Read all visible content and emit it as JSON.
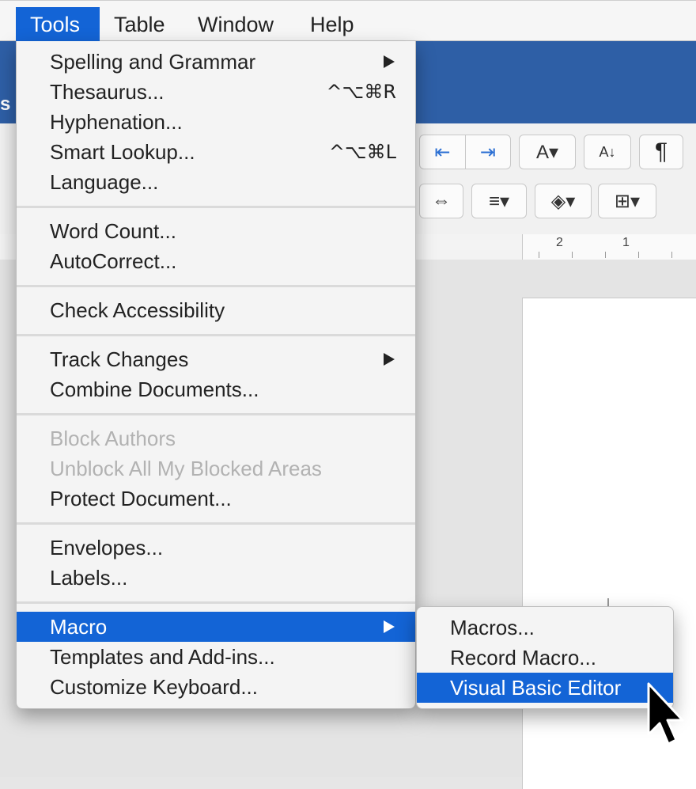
{
  "menubar": {
    "items": [
      {
        "label": "Tools",
        "active": true
      },
      {
        "label": "Table"
      },
      {
        "label": "Window"
      },
      {
        "label": "Help"
      }
    ]
  },
  "tools_menu": {
    "groups": [
      [
        {
          "label": "Spelling and Grammar",
          "submenu": true
        },
        {
          "label": "Thesaurus...",
          "shortcut": "^⌥⌘R"
        },
        {
          "label": "Hyphenation..."
        },
        {
          "label": "Smart Lookup...",
          "shortcut": "^⌥⌘L"
        },
        {
          "label": "Language..."
        }
      ],
      [
        {
          "label": "Word Count..."
        },
        {
          "label": "AutoCorrect..."
        }
      ],
      [
        {
          "label": "Check Accessibility"
        }
      ],
      [
        {
          "label": "Track Changes",
          "submenu": true
        },
        {
          "label": "Combine Documents..."
        }
      ],
      [
        {
          "label": "Block Authors",
          "disabled": true
        },
        {
          "label": "Unblock All My Blocked Areas",
          "disabled": true
        },
        {
          "label": "Protect Document..."
        }
      ],
      [
        {
          "label": "Envelopes..."
        },
        {
          "label": "Labels..."
        }
      ],
      [
        {
          "label": "Macro",
          "submenu": true,
          "highlighted": true
        },
        {
          "label": "Templates and Add-ins..."
        },
        {
          "label": "Customize Keyboard..."
        }
      ]
    ]
  },
  "macro_submenu": {
    "items": [
      {
        "label": "Macros..."
      },
      {
        "label": "Record Macro..."
      },
      {
        "label": "Visual Basic Editor",
        "highlighted": true
      }
    ]
  },
  "ruler": {
    "labels": [
      "2",
      "1"
    ]
  },
  "ribbon": {
    "icons": [
      "decrease-indent-icon",
      "increase-indent-icon",
      "text-direction-icon",
      "sort-icon",
      "paragraph-marks-icon",
      "line-spacing-icon",
      "shading-icon",
      "borders-icon",
      "distributed-icon"
    ]
  },
  "accent_color": "#1364d6",
  "titlebar_color": "#2e5fa6"
}
